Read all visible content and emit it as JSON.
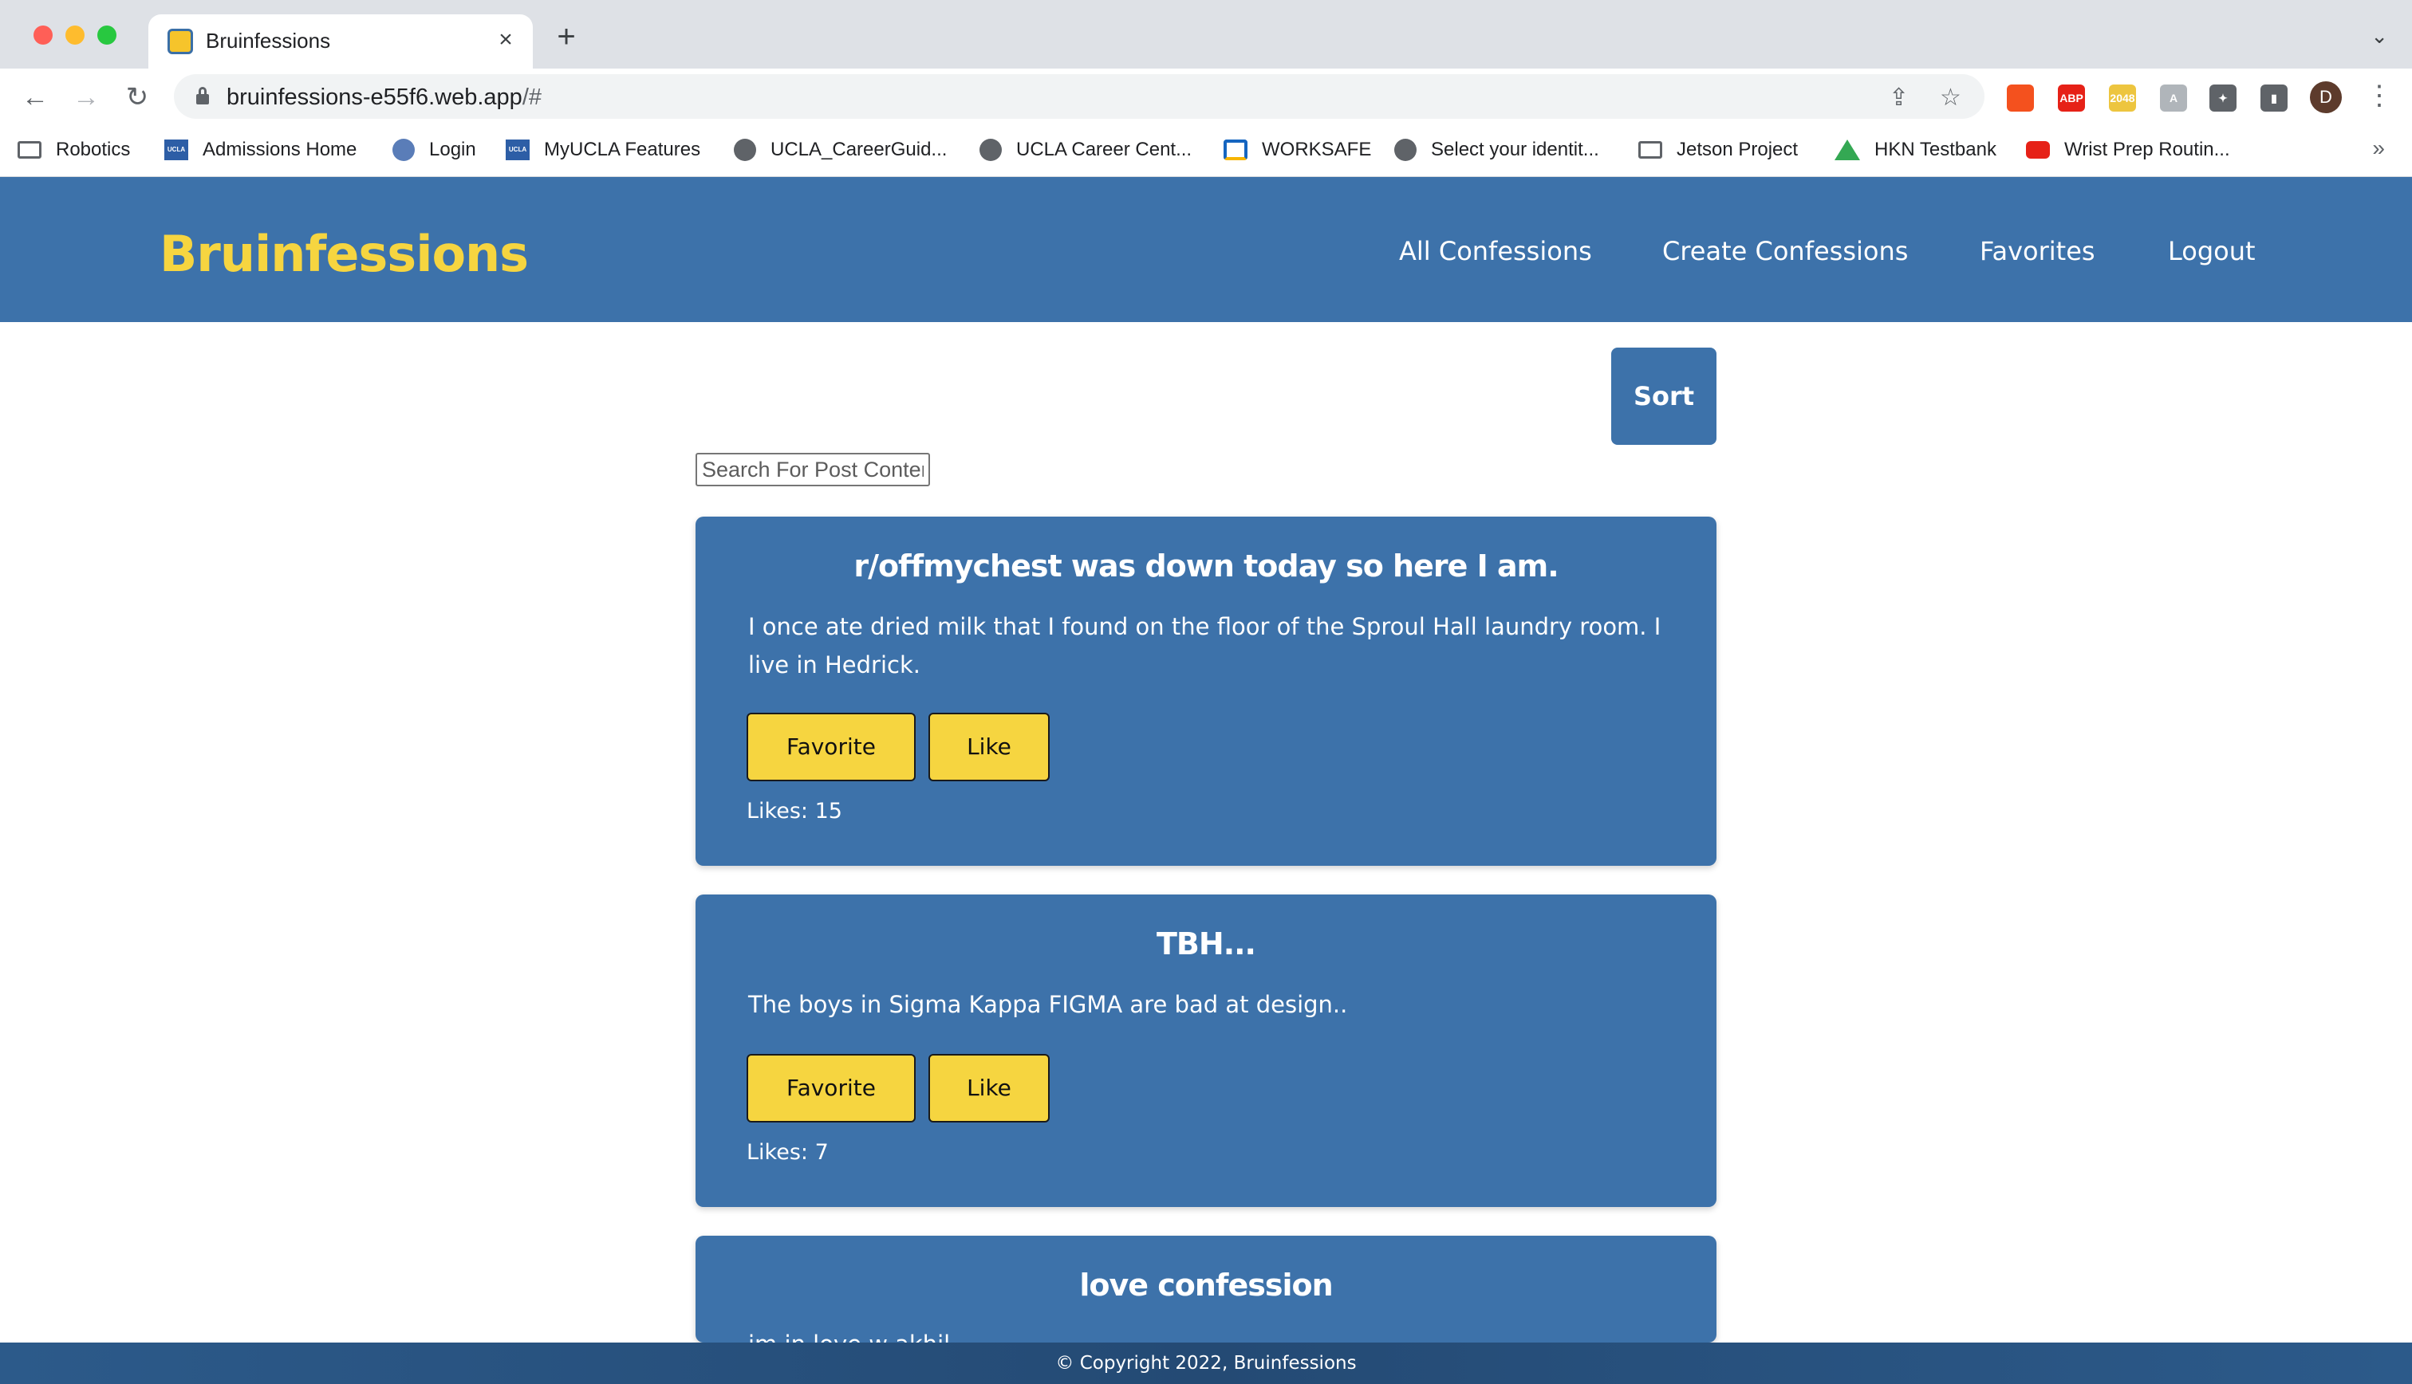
{
  "browser": {
    "tab_title": "Bruinfessions",
    "tab_close": "×",
    "new_tab": "+",
    "tab_search": "⌄",
    "back": "←",
    "forward": "→",
    "reload": "↻",
    "url_host": "bruinfessions-e55f6.web.app",
    "url_path": "/#",
    "share": "⇪",
    "star": "☆",
    "avatar_letter": "D",
    "menu": "⋮",
    "extensions": [
      {
        "name": "firebase-extension-icon",
        "label": "",
        "color": "#f4511e"
      },
      {
        "name": "adblock-plus-icon",
        "label": "ABP",
        "color": "#e62117"
      },
      {
        "name": "2048-extension-icon",
        "label": "2048",
        "color": "#edc53f"
      },
      {
        "name": "gray-extension-icon",
        "label": "A",
        "color": "#b0b5ba"
      },
      {
        "name": "puzzle-icon",
        "label": "✦",
        "color": "#5f6368"
      },
      {
        "name": "side-panel-icon",
        "label": "▮",
        "color": "#5f6368"
      }
    ],
    "bookmarks": [
      {
        "label": "Robotics",
        "icon": "folder"
      },
      {
        "label": "Admissions Home",
        "icon": "ucla"
      },
      {
        "label": "Login",
        "icon": "login"
      },
      {
        "label": "MyUCLA Features",
        "icon": "ucla"
      },
      {
        "label": "UCLA_CareerGuid...",
        "icon": "globe"
      },
      {
        "label": "UCLA Career Cent...",
        "icon": "globe"
      },
      {
        "label": "WORKSAFE",
        "icon": "worksafe"
      },
      {
        "label": "Select your identit...",
        "icon": "globe"
      },
      {
        "label": "Jetson Project",
        "icon": "folder"
      },
      {
        "label": "HKN Testbank",
        "icon": "drive"
      },
      {
        "label": "Wrist Prep Routin...",
        "icon": "youtube"
      }
    ],
    "bookmarks_more": "»"
  },
  "site": {
    "brand": "Bruinfessions",
    "nav": [
      "All Confessions",
      "Create Confessions",
      "Favorites",
      "Logout"
    ],
    "sort_label": "Sort",
    "search_placeholder": "Search For Post Content"
  },
  "posts": [
    {
      "title": "r/offmychest was down today so here I am.",
      "body": "I once ate dried milk that I found on the floor of the Sproul Hall laundry room. I live in Hedrick.",
      "favorite_label": "Favorite",
      "like_label": "Like",
      "likes": "Likes: 15"
    },
    {
      "title": "TBH...",
      "body": "The boys in Sigma Kappa FIGMA are bad at design..",
      "favorite_label": "Favorite",
      "like_label": "Like",
      "likes": "Likes: 7"
    },
    {
      "title": "love confession",
      "body": "im in love w akhil"
    }
  ],
  "footer": "© Copyright 2022, Bruinfessions",
  "colors": {
    "header_blue": "#3d72aa",
    "brand_yellow": "#f6d540",
    "button_yellow": "#f6d540"
  }
}
